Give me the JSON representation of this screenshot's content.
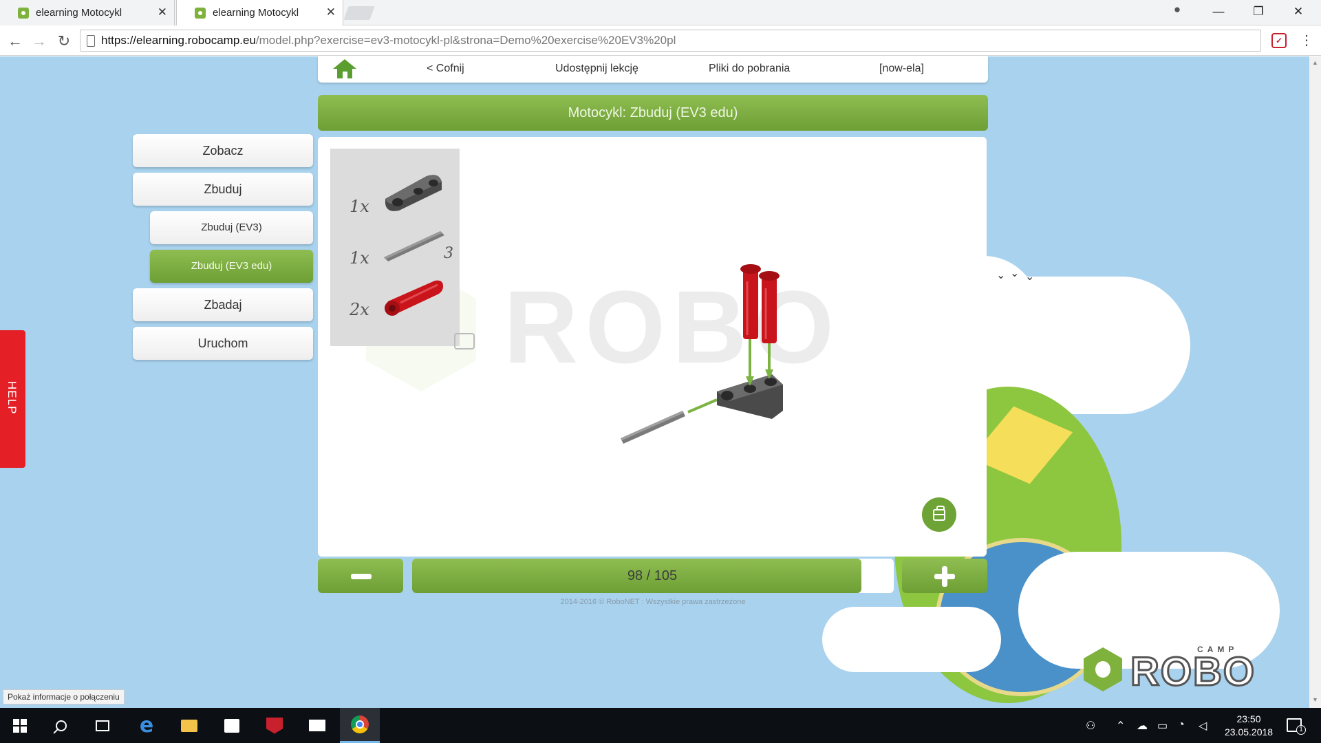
{
  "browser": {
    "tabs": [
      {
        "title": "elearning Motocykl",
        "active": false
      },
      {
        "title": "elearning Motocykl",
        "active": true
      }
    ],
    "url_host": "https://elearning.robocamp.eu",
    "url_path": "/model.php?exercise=ev3-motocykl-pl&strona=Demo%20exercise%20EV3%20pl",
    "window_controls": {
      "minimize": "—",
      "restore": "❐",
      "close": "✕"
    }
  },
  "topnav": {
    "back": "< Cofnij",
    "share": "Udostępnij lekcję",
    "downloads": "Pliki do pobrania",
    "user": "[now-ela]"
  },
  "title": "Motocykl: Zbuduj (EV3 edu)",
  "side_menu": {
    "see": "Zobacz",
    "build": "Zbuduj",
    "build_ev3": "Zbuduj (EV3)",
    "build_ev3_edu": "Zbuduj (EV3 edu)",
    "explore": "Zbadaj",
    "run": "Uruchom"
  },
  "help": "HELP",
  "parts": [
    {
      "qty": "1x",
      "name": "beam-connector"
    },
    {
      "qty": "1x",
      "name": "axle",
      "length": "3"
    },
    {
      "qty": "2x",
      "name": "red-pin"
    }
  ],
  "pager": {
    "label": "98 / 105",
    "current": 98,
    "total": 105
  },
  "copyright": "2014-2016 © RoboNET : Wszystkie prawa zastrzeżone",
  "logo": {
    "camp": "CAMP",
    "robo": "ROBO"
  },
  "status_tooltip": "Pokaż informacje o połączeniu",
  "taskbar": {
    "time": "23:50",
    "date": "23.05.2018",
    "notifications": "1"
  },
  "colors": {
    "accent_green": "#7fb13d",
    "sky": "#a8d2ee",
    "help_red": "#e41f26"
  }
}
